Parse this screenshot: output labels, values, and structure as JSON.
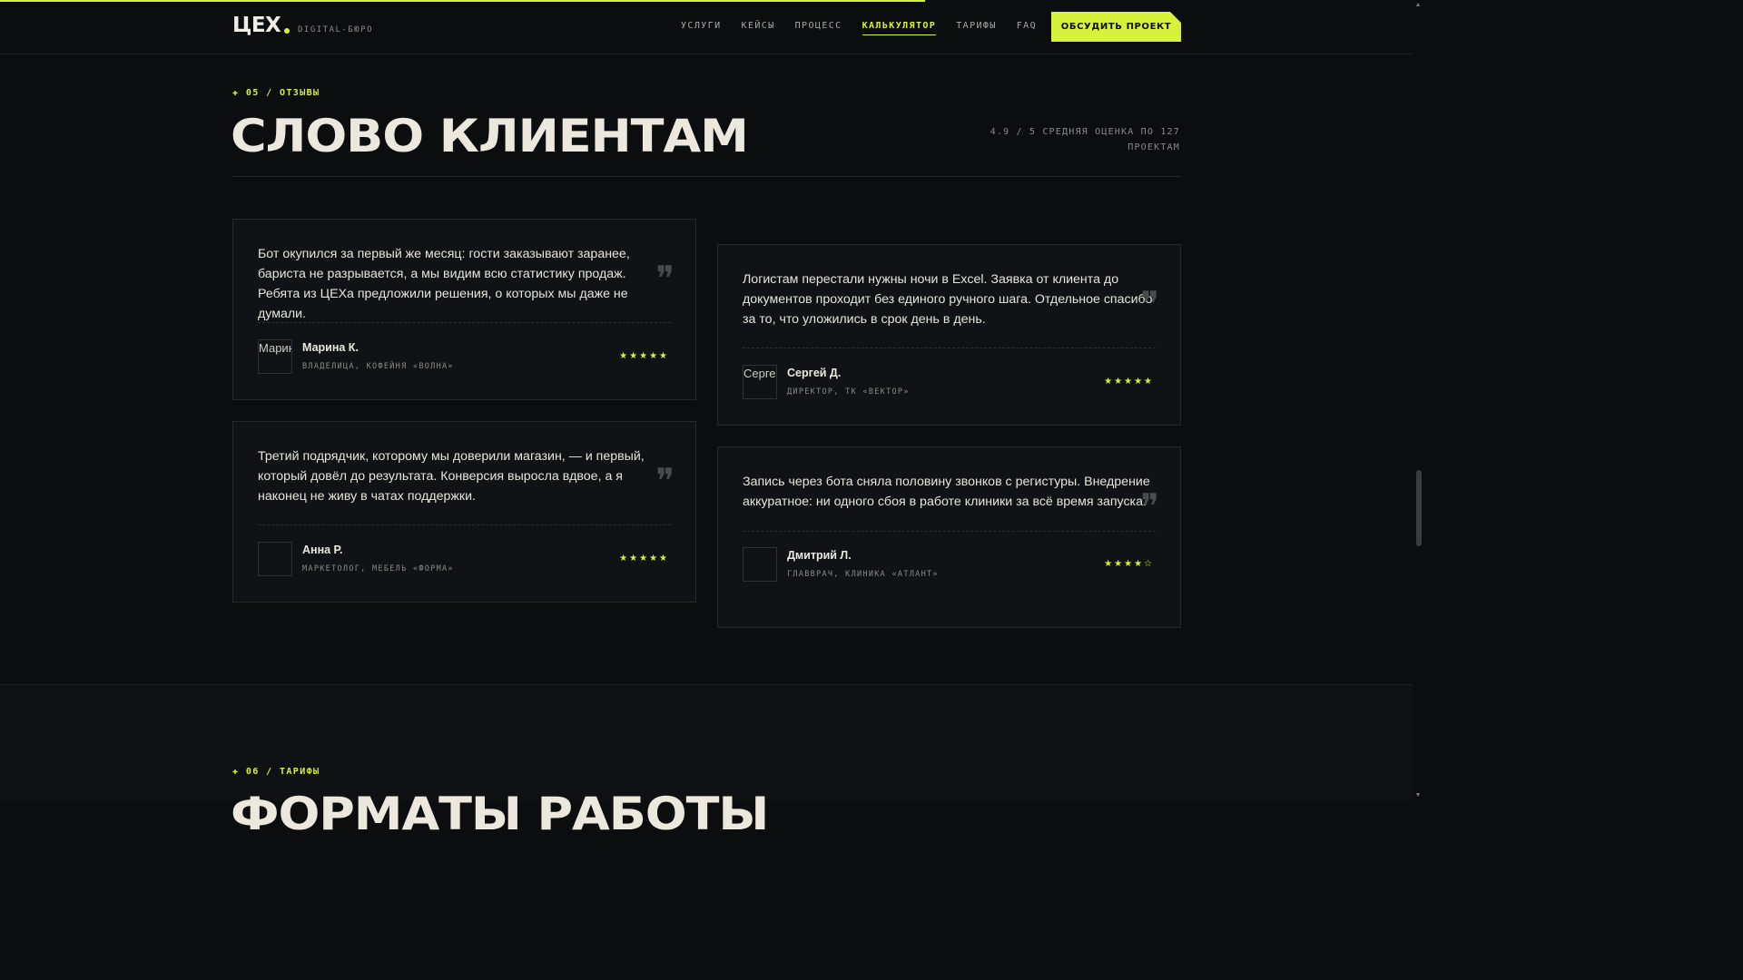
{
  "header": {
    "logo": "ЦЕХ",
    "logo_sub": "DIGITAL-БЮРО",
    "nav": [
      {
        "label": "УСЛУГИ"
      },
      {
        "label": "КЕЙСЫ"
      },
      {
        "label": "ПРОЦЕСС"
      },
      {
        "label": "КАЛЬКУЛЯТОР",
        "active": true
      },
      {
        "label": "ТАРИФЫ"
      },
      {
        "label": "FAQ"
      }
    ],
    "cta_label": "ОБСУДИТЬ ПРОЕКТ"
  },
  "reviews_section": {
    "eyebrow": "✚ 05 / ОТЗЫВЫ",
    "title": "СЛОВО КЛИЕНТАМ",
    "rating_line1": "4.9 / 5 СРЕДНЯЯ ОЦЕНКА ПО 127",
    "rating_line2": "ПРОЕКТАМ",
    "cards": [
      {
        "quote": "Бот окупился за первый же месяц: гости заказывают заранее, бариста не разрывается, а мы видим всю статистику продаж. Ребята из ЦЕХа предложили решения, о которых мы даже не думали.",
        "avatar_alt": "Марина К.",
        "author": "Марина К.",
        "role": "ВЛАДЕЛИЦА, КОФЕЙНЯ «ВОЛНА»",
        "stars": "★★★★★"
      },
      {
        "quote": "Логистам перестали нужны ночи в Excel. Заявка от клиента до документов проходит без единого ручного шага. Отдельное спасибо за то, что уложились в срок день в день.",
        "avatar_alt": "Сергей Д.",
        "author": "Сергей Д.",
        "role": "ДИРЕКТОР, ТК «ВЕКТОР»",
        "stars": "★★★★★"
      },
      {
        "quote": "Третий подрядчик, которому мы доверили магазин, — и первый, который довёл до результата. Конверсия выросла вдвое, а я наконец не живу в чатах поддержки.",
        "avatar_alt": "",
        "author": "Анна Р.",
        "role": "МАРКЕТОЛОГ, МЕБЕЛЬ «ФОРМА»",
        "stars": "★★★★★"
      },
      {
        "quote": "Запись через бота сняла половину звонков с регистуры. Внедрение аккуратное: ни одного сбоя в работе клиники за всё время запуска.",
        "avatar_alt": "",
        "author": "Дмитрий Л.",
        "role": "ГЛАВВРАЧ, КЛИНИКА «АТЛАНТ»",
        "stars": "★★★★☆"
      }
    ]
  },
  "pricing_section": {
    "eyebrow": "✚ 06 / ТАРИФЫ",
    "title": "ФОРМАТЫ РАБОТЫ"
  },
  "colors": {
    "accent": "#d8f23b",
    "background": "#0c0d0f",
    "card": "#111215"
  }
}
